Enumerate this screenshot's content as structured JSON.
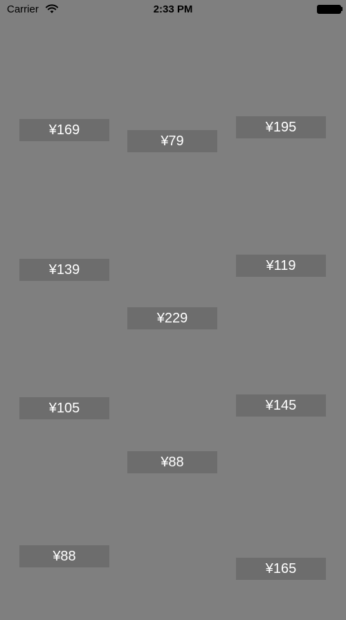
{
  "status_bar": {
    "carrier": "Carrier",
    "time": "2:33 PM"
  },
  "products": [
    {
      "price": "¥169",
      "colors": [
        "#d9d2c2",
        "#f2ede3",
        "#c9c2b0"
      ]
    },
    {
      "price": "¥79",
      "colors": [
        "#f1a8c4",
        "#111111",
        "#c0e060"
      ]
    },
    {
      "price": "¥195",
      "colors": [
        "#e9e8e6",
        "#bfbebd",
        "#2a2a2a"
      ]
    },
    {
      "price": "¥139",
      "colors": [
        "#f3f3f3",
        "#e4e4e4",
        "#3a2b25"
      ]
    },
    {
      "price": "¥229",
      "colors": [
        "#ece1c6",
        "#c9b490",
        "#4a3828"
      ]
    },
    {
      "price": "¥119",
      "colors": [
        "#8fa48d",
        "#6f856d",
        "#4a4a4a"
      ]
    },
    {
      "price": "¥105",
      "colors": [
        "#1f4fd1",
        "#f4f4f4",
        "#1b3a9a"
      ]
    },
    {
      "price": "¥88",
      "colors": [
        "#cdb08f",
        "#b89470",
        "#3a2e25"
      ]
    },
    {
      "price": "¥145",
      "colors": [
        "#1c1c1c",
        "#6b6b6b",
        "#c8b000"
      ]
    },
    {
      "price": "¥88",
      "colors": [
        "#1f3a28",
        "#d8cfb8",
        "#e0a030"
      ]
    },
    {
      "price": "¥165",
      "colors": [
        "#a9d8c4",
        "#f3f3f3",
        "#5a5a5a"
      ]
    },
    {
      "price": "",
      "colors": [
        "#dc2f3a",
        "#f2f2f2",
        "#b31c28"
      ]
    },
    {
      "price": "",
      "colors": [
        "#2a2a2a",
        "#f5f5f5",
        "#9a9a9a"
      ]
    },
    {
      "price": "",
      "colors": [
        "#d9d9d9",
        "#f2f2f2",
        "#2b2b2b"
      ]
    }
  ]
}
